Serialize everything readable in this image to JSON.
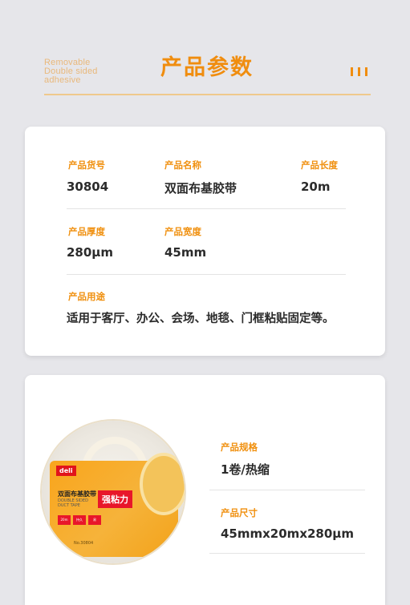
{
  "header": {
    "tagline": "Removable\nDouble sided\nadhesive",
    "title": "产品参数",
    "accent_color": "#f08d0f"
  },
  "specs": {
    "item_no_label": "产品货号",
    "item_no": "30804",
    "name_label": "产品名称",
    "name": "双面布基胶带",
    "length_label": "产品长度",
    "length": "20m",
    "thickness_label": "产品厚度",
    "thickness": "280μm",
    "width_label": "产品宽度",
    "width": "45mm",
    "usage_label": "产品用途",
    "usage": "适用于客厅、办公、会场、地毯、门框粘贴固定等。"
  },
  "product_image": {
    "brand": "deli",
    "box_title": "双面布基胶带",
    "box_subtitle": "DOUBLE SIDED DUCT TAPE",
    "box_tag": "强粘力",
    "chips": [
      "20m",
      "持久",
      "易"
    ],
    "box_no": "No.30804"
  },
  "package": {
    "spec_label": "产品规格",
    "spec": "1卷/热缩",
    "size_label": "产品尺寸",
    "size": "45mmx20mx280μm"
  }
}
